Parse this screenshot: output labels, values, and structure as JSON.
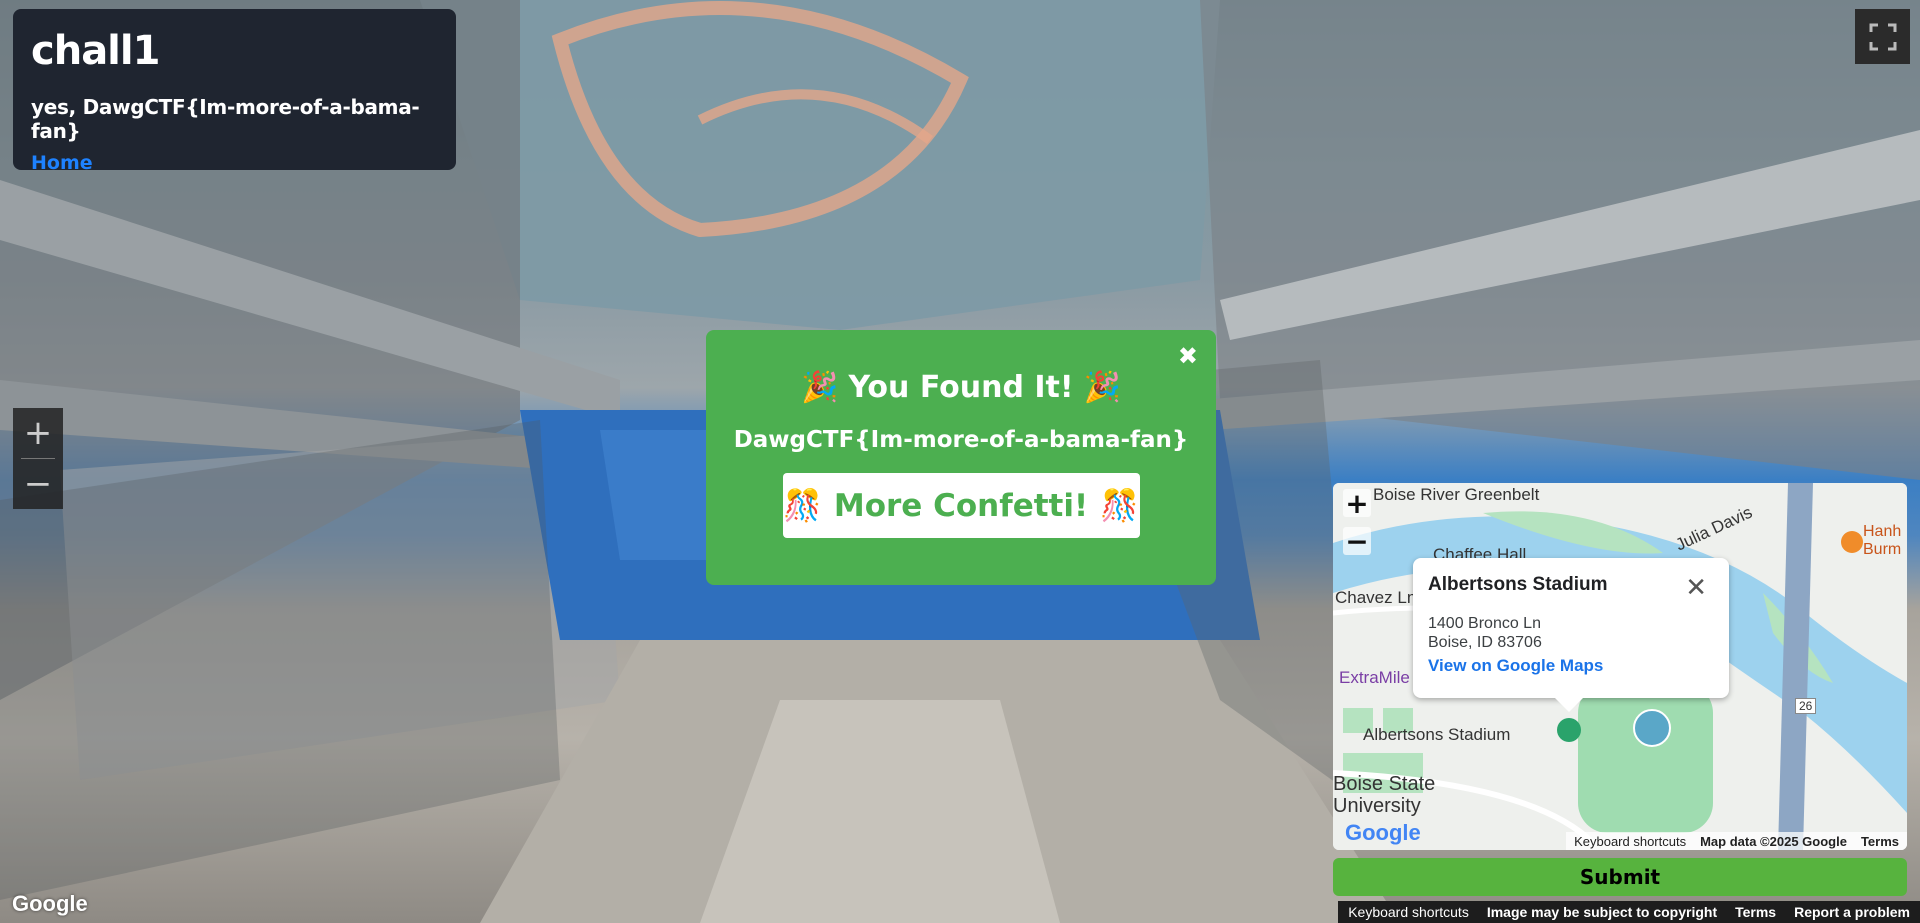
{
  "info": {
    "title": "chall1",
    "subtitle": "yes, DawgCTF{Im-more-of-a-bama-fan}",
    "home_link": "Home"
  },
  "modal": {
    "close": "✖",
    "title": "You Found It!",
    "flag": "DawgCTF{Im-more-of-a-bama-fan}",
    "confetti_button": "More Confetti!"
  },
  "streetview": {
    "zoom_in": "+",
    "zoom_out": "−",
    "google_logo": "Google",
    "footer": {
      "keyboard": "Keyboard shortcuts",
      "copyright": "Image may be subject to copyright",
      "terms": "Terms",
      "report": "Report a problem"
    }
  },
  "map": {
    "zoom_in": "+",
    "zoom_out": "−",
    "labels": {
      "greenbelt": "Boise River Greenbelt",
      "chaffee": "Chaffee Hall",
      "julia": "Julia Davis",
      "chavez": "Chavez Ln",
      "extramile": "ExtraMile",
      "stadium": "Albertsons Stadium",
      "bsu": "Boise State University",
      "route": "26",
      "restaurant": "Hanh Burm"
    },
    "popup": {
      "title": "Albertsons Stadium",
      "address_line1": "1400 Bronco Ln",
      "address_line2": "Boise, ID 83706",
      "link": "View on Google Maps"
    },
    "footer": {
      "keyboard": "Keyboard shortcuts",
      "data": "Map data ©2025 Google",
      "terms": "Terms"
    },
    "google_logo": "Google"
  },
  "submit_button": "Submit",
  "colors": {
    "panel_bg": "#1f2530",
    "link": "#1e82ff",
    "modal_bg": "#4caf50",
    "submit_bg": "#57b33e"
  }
}
